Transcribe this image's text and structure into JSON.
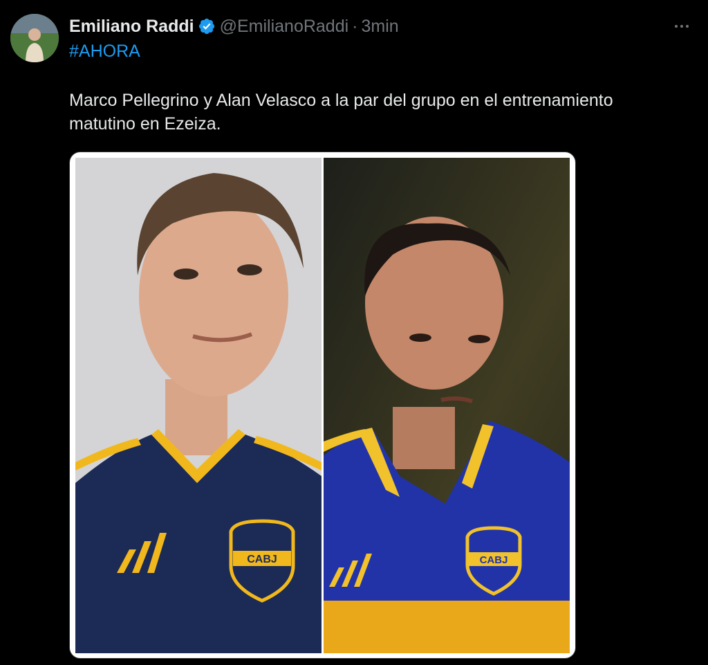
{
  "tweet": {
    "author": {
      "name": "Emiliano Raddi",
      "handle": "@EmilianoRaddi",
      "verified": true,
      "avatar_icon": "profile-photo"
    },
    "separator": "·",
    "time": "3min",
    "hashtag": "#AHORA",
    "body": "Marco Pellegrino y Alan Velasco a la par del grupo en el entrenamiento matutino en Ezeiza.",
    "more_icon": "more-horizontal-icon",
    "media": {
      "left_badge_text": "CABJ",
      "right_badge_text": "CABJ"
    }
  },
  "colors": {
    "background": "#000000",
    "text": "#e7e9ea",
    "secondary": "#71767b",
    "link": "#1d9bf0",
    "verified": "#1d9bf0",
    "jersey_blue": "#1c2a6b",
    "jersey_gold": "#f1b81d"
  }
}
